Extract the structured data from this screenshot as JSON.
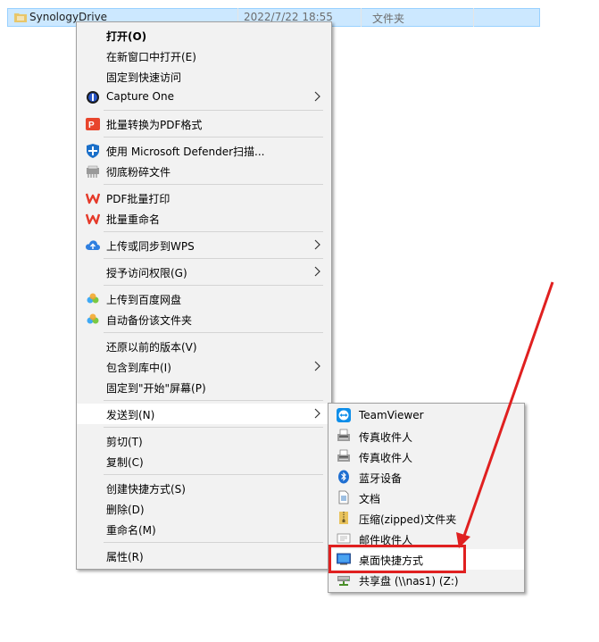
{
  "file_row": {
    "name": "SynologyDrive",
    "date": "2022/7/22 18:55",
    "type": "文件夹"
  },
  "menu": {
    "items": [
      {
        "label": "打开(O)"
      },
      {
        "label": "在新窗口中打开(E)"
      },
      {
        "label": "固定到快速访问"
      },
      {
        "label": "Capture One"
      },
      {
        "label": "批量转换为PDF格式"
      },
      {
        "label": "使用 Microsoft Defender扫描..."
      },
      {
        "label": "彻底粉碎文件"
      },
      {
        "label": "PDF批量打印"
      },
      {
        "label": "批量重命名"
      },
      {
        "label": "上传或同步到WPS"
      },
      {
        "label": "授予访问权限(G)"
      },
      {
        "label": "上传到百度网盘"
      },
      {
        "label": "自动备份该文件夹"
      },
      {
        "label": "还原以前的版本(V)"
      },
      {
        "label": "包含到库中(I)"
      },
      {
        "label": "固定到\"开始\"屏幕(P)"
      },
      {
        "label": "发送到(N)"
      },
      {
        "label": "剪切(T)"
      },
      {
        "label": "复制(C)"
      },
      {
        "label": "创建快捷方式(S)"
      },
      {
        "label": "删除(D)"
      },
      {
        "label": "重命名(M)"
      },
      {
        "label": "属性(R)"
      }
    ]
  },
  "submenu": {
    "items": [
      {
        "label": "TeamViewer"
      },
      {
        "label": "传真收件人"
      },
      {
        "label": "传真收件人"
      },
      {
        "label": "蓝牙设备"
      },
      {
        "label": "文档"
      },
      {
        "label": "压缩(zipped)文件夹"
      },
      {
        "label": "邮件收件人"
      },
      {
        "label": "桌面快捷方式"
      },
      {
        "label": "共享盘 (\\\\nas1) (Z:)"
      }
    ]
  },
  "colors": {
    "highlight": "#e02020",
    "selection": "#cce8ff"
  }
}
